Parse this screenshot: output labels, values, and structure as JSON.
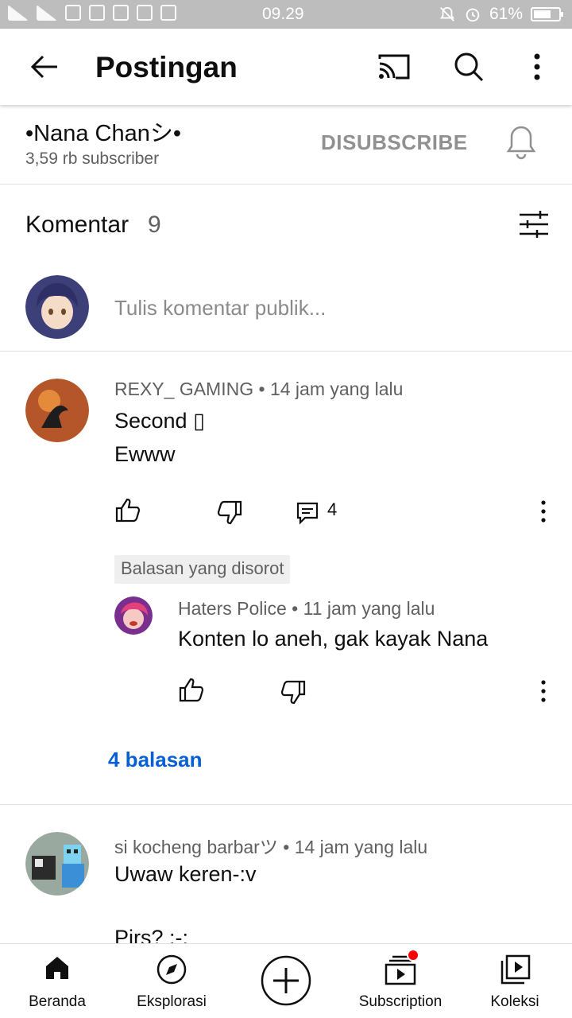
{
  "status_bar": {
    "time": "09.29",
    "battery": "61%"
  },
  "app_bar": {
    "title": "Postingan",
    "icons": [
      "back-arrow-icon",
      "cast-icon",
      "search-icon",
      "more-vert-icon"
    ]
  },
  "channel": {
    "name": "•Nana Chanシ•",
    "subscribers": "3,59 rb subscriber",
    "unsubscribe_label": "DISUBSCRIBE"
  },
  "comments_section": {
    "label": "Komentar",
    "count": "9",
    "compose_placeholder": "Tulis komentar publik..."
  },
  "comments": [
    {
      "author": "REXY_ GAMING",
      "time": "14 jam yang lalu",
      "lines": [
        "Second ▯",
        "Ewww"
      ],
      "reply_count": "4",
      "highlight_label": "Balasan yang disorot",
      "highlighted_reply": {
        "author": "Haters Police",
        "time": "11 jam yang lalu",
        "text": "Konten lo aneh, gak kayak Nana"
      },
      "more_replies": "4 balasan"
    },
    {
      "author": "si kocheng barbarツ",
      "time": "14 jam yang lalu",
      "lines": [
        "Uwaw keren-:v",
        "Pirs? :-:"
      ]
    }
  ],
  "bottom_nav": [
    {
      "label": "Beranda",
      "icon": "home-icon"
    },
    {
      "label": "Eksplorasi",
      "icon": "compass-icon"
    },
    {
      "label": "",
      "icon": "create-icon"
    },
    {
      "label": "Subscription",
      "icon": "subscriptions-icon"
    },
    {
      "label": "Koleksi",
      "icon": "library-icon"
    }
  ],
  "colors": {
    "status_bar": "#bdbdbd",
    "link": "#065fd4",
    "badge": "#ff0000"
  }
}
